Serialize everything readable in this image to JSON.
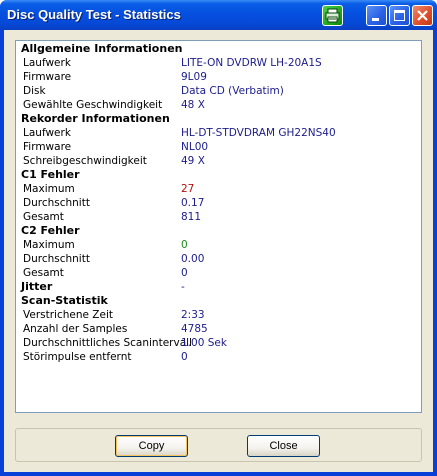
{
  "window": {
    "title": "Disc Quality Test - Statistics"
  },
  "sections": [
    {
      "header": "Allgemeine Informationen",
      "rows": [
        {
          "label": "Laufwerk",
          "value": "LITE-ON DVDRW LH-20A1S"
        },
        {
          "label": "Firmware",
          "value": "9L09"
        },
        {
          "label": "Disk",
          "value": "Data CD (Verbatim)"
        },
        {
          "label": "Gewählte Geschwindigkeit",
          "value": "48 X"
        }
      ]
    },
    {
      "header": "Rekorder Informationen",
      "rows": [
        {
          "label": "Laufwerk",
          "value": "HL-DT-STDVDRAM GH22NS40"
        },
        {
          "label": "Firmware",
          "value": "NL00"
        },
        {
          "label": "Schreibgeschwindigkeit",
          "value": "49 X"
        }
      ]
    },
    {
      "header": "C1 Fehler",
      "rows": [
        {
          "label": "Maximum",
          "value": "27",
          "color": "#b01010"
        },
        {
          "label": "Durchschnitt",
          "value": "0.17"
        },
        {
          "label": "Gesamt",
          "value": "811"
        }
      ]
    },
    {
      "header": "C2 Fehler",
      "rows": [
        {
          "label": "Maximum",
          "value": "0",
          "color": "#1a8a1a"
        },
        {
          "label": "Durchschnitt",
          "value": "0.00"
        },
        {
          "label": "Gesamt",
          "value": "0"
        }
      ]
    },
    {
      "header": "Jitter",
      "header_value": "-",
      "rows": []
    },
    {
      "header": "Scan-Statistik",
      "rows": [
        {
          "label": "Verstrichene Zeit",
          "value": "2:33"
        },
        {
          "label": "Anzahl der Samples",
          "value": "4785"
        },
        {
          "label": "Durchschnittliches Scanintervall",
          "value": "1.00 Sek"
        },
        {
          "label": "Störimpulse entfernt",
          "value": "0"
        }
      ]
    }
  ],
  "buttons": {
    "copy": "Copy",
    "close": "Close"
  },
  "icons": {
    "print": "printer-icon",
    "minimize": "minimize-icon",
    "maximize": "maximize-icon",
    "close": "close-icon"
  }
}
